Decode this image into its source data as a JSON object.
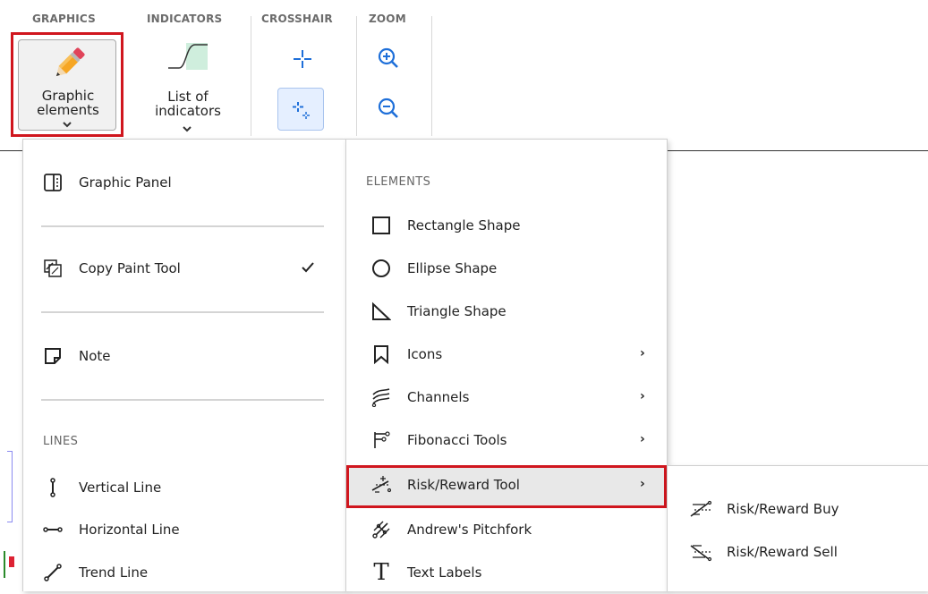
{
  "ribbon": {
    "groups": {
      "graphics": "GRAPHICS",
      "indicators": "INDICATORS",
      "crosshair": "CROSSHAIR",
      "zoom": "ZOOM"
    },
    "graphic_elements": {
      "line1": "Graphic",
      "line2": "elements"
    },
    "list_of_indicators": {
      "line1": "List of",
      "line2": "indicators"
    }
  },
  "left_menu": {
    "graphic_panel": "Graphic Panel",
    "copy_paint_tool": "Copy Paint Tool",
    "copy_paint_checked": true,
    "note": "Note",
    "lines_header": "LINES",
    "lines": [
      "Vertical Line",
      "Horizontal Line",
      "Trend Line"
    ]
  },
  "elements_menu": {
    "header": "ELEMENTS",
    "items": [
      "Rectangle Shape",
      "Ellipse Shape",
      "Triangle Shape",
      "Icons",
      "Channels",
      "Fibonacci Tools",
      "Risk/Reward Tool",
      "Andrew's Pitchfork",
      "Text Labels"
    ]
  },
  "risk_reward_submenu": {
    "items": [
      "Risk/Reward Buy",
      "Risk/Reward Sell"
    ]
  },
  "colors": {
    "highlight": "#d0161e",
    "accent": "#1e6fd9"
  }
}
